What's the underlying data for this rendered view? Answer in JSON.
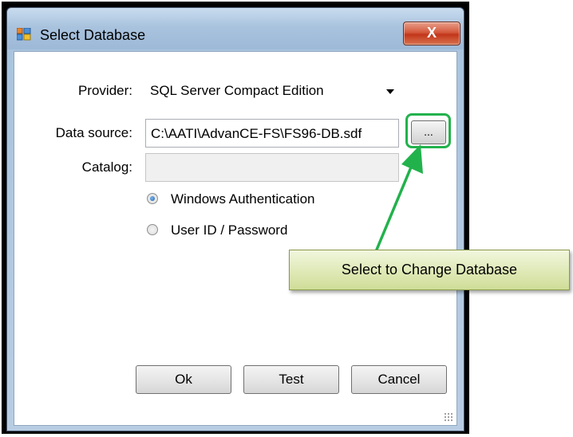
{
  "window": {
    "title": "Select Database",
    "close_glyph": "X",
    "app_icon": "database-window-icon"
  },
  "form": {
    "provider_label": "Provider:",
    "provider_value": "SQL Server Compact Edition",
    "datasource_label": "Data source:",
    "datasource_value": "C:\\AATI\\AdvanCE-FS\\FS96-DB.sdf",
    "browse_label": "...",
    "catalog_label": "Catalog:",
    "catalog_value": "",
    "auth_options": [
      {
        "label": "Windows Authentication",
        "checked": true
      },
      {
        "label": "User ID / Password",
        "checked": false
      }
    ]
  },
  "buttons": {
    "ok": "Ok",
    "test": "Test",
    "cancel": "Cancel"
  },
  "annotation": {
    "text": "Select to Change Database",
    "highlight_color": "#22b24c",
    "arrow_color": "#22b24c"
  }
}
